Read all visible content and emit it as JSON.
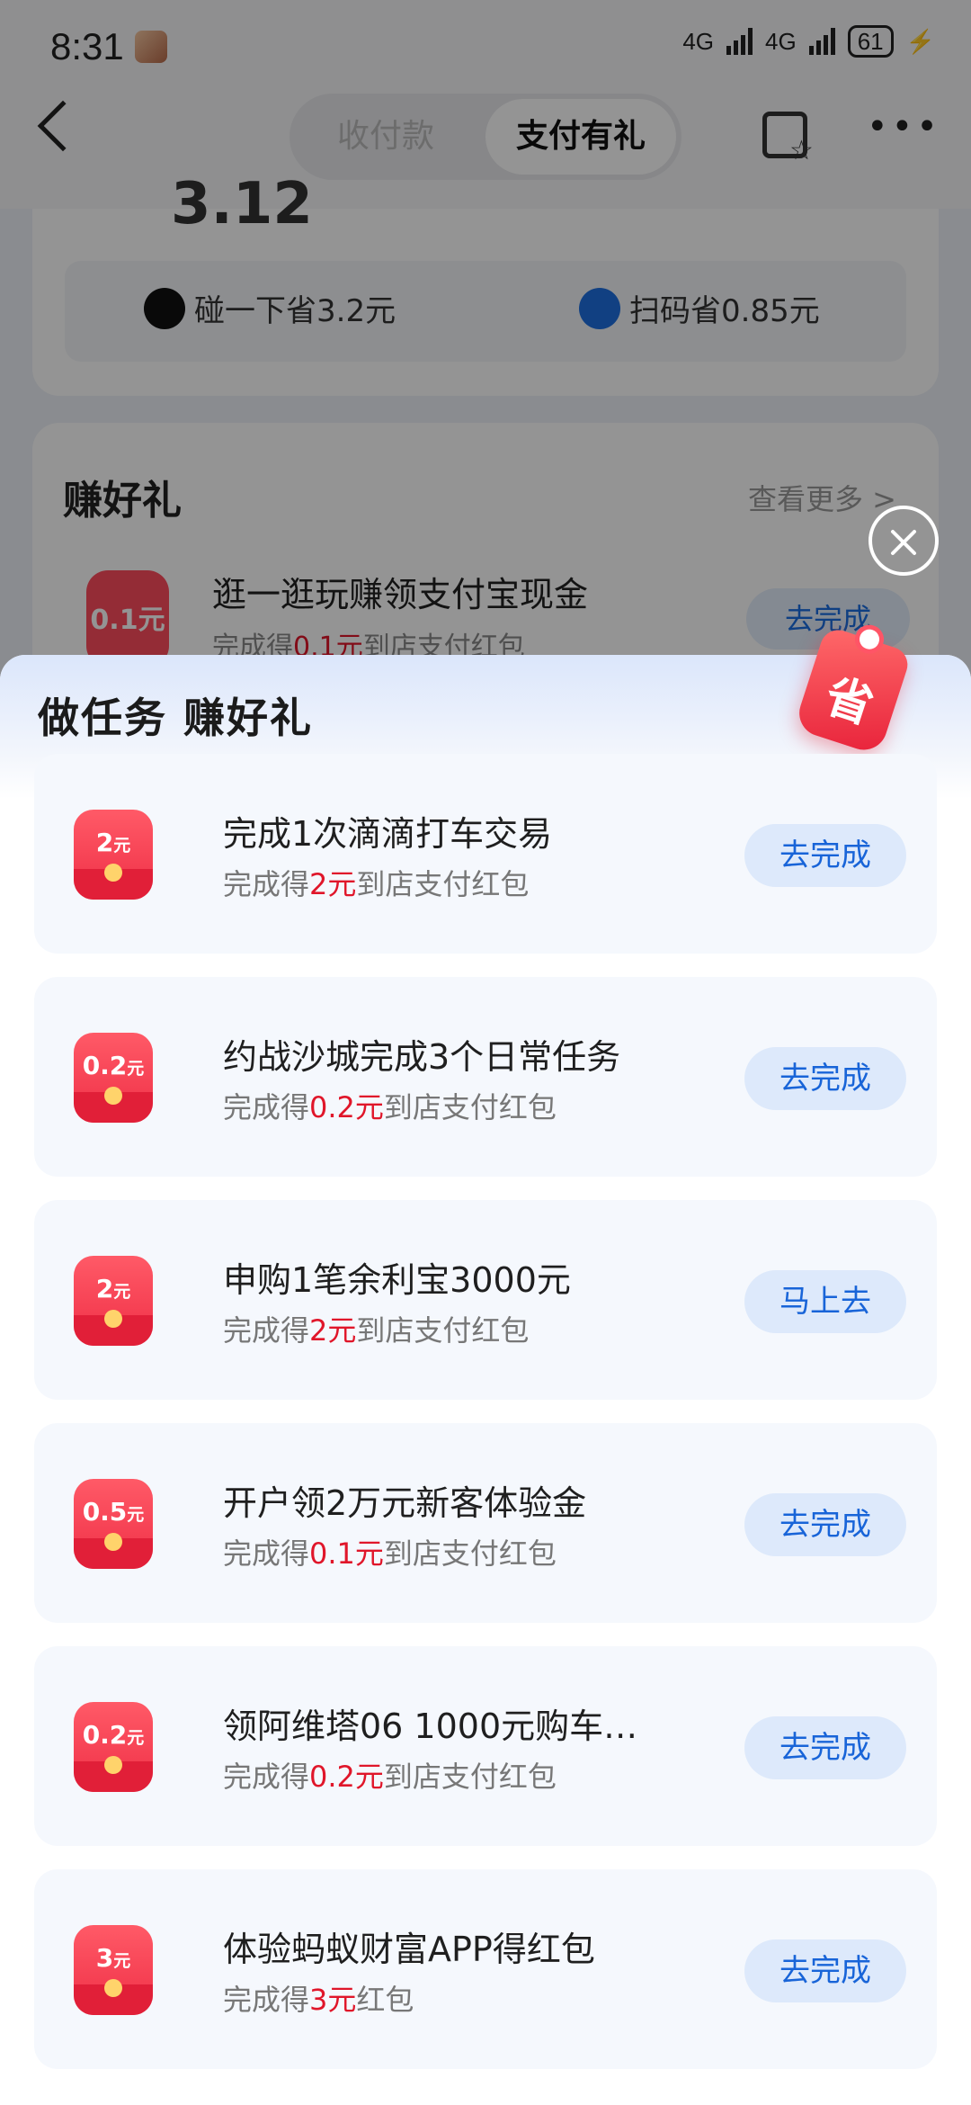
{
  "status_bar": {
    "time": "8:31",
    "battery": "61",
    "network_1": "4G",
    "network_2": "4G"
  },
  "nav": {
    "tab_collect": "收付款",
    "tab_gift": "支付有礼"
  },
  "summary": {
    "partial_amount": "3.12",
    "tap_save": "碰一下省3.2元",
    "scan_save": "扫码省0.85元"
  },
  "earn_section": {
    "title": "赚好礼",
    "more": "查看更多 >",
    "task": "逛一逛玩赚领支付宝现金",
    "badge": "0.1元",
    "sub_prefix": "完成得",
    "sub_amount": "0.1元",
    "sub_suffix": "到店支付红包",
    "button": "去完成"
  },
  "sheet": {
    "title": "做任务 赚好礼",
    "tag_text": "省"
  },
  "tasks": [
    {
      "badge_num": "2",
      "badge_unit": "元",
      "title": "完成1次滴滴打车交易",
      "sub_prefix": "完成得",
      "sub_amount": "2元",
      "sub_suffix": "到店支付红包",
      "button": "去完成"
    },
    {
      "badge_num": "0.2",
      "badge_unit": "元",
      "title": "约战沙城完成3个日常任务",
      "sub_prefix": "完成得",
      "sub_amount": "0.2元",
      "sub_suffix": "到店支付红包",
      "button": "去完成"
    },
    {
      "badge_num": "2",
      "badge_unit": "元",
      "title": "申购1笔余利宝3000元",
      "sub_prefix": "完成得",
      "sub_amount": "2元",
      "sub_suffix": "到店支付红包",
      "button": "马上去"
    },
    {
      "badge_num": "0.5",
      "badge_unit": "元",
      "title": "开户领2万元新客体验金",
      "sub_prefix": "完成得",
      "sub_amount": "0.1元",
      "sub_suffix": "到店支付红包",
      "button": "去完成"
    },
    {
      "badge_num": "0.2",
      "badge_unit": "元",
      "title": "领阿维塔06 1000元购车…",
      "sub_prefix": "完成得",
      "sub_amount": "0.2元",
      "sub_suffix": "到店支付红包",
      "button": "去完成"
    },
    {
      "badge_num": "3",
      "badge_unit": "元",
      "title": "体验蚂蚁财富APP得红包",
      "sub_prefix": "完成得",
      "sub_amount": "3元",
      "sub_suffix": "红包",
      "button": "去完成"
    }
  ]
}
